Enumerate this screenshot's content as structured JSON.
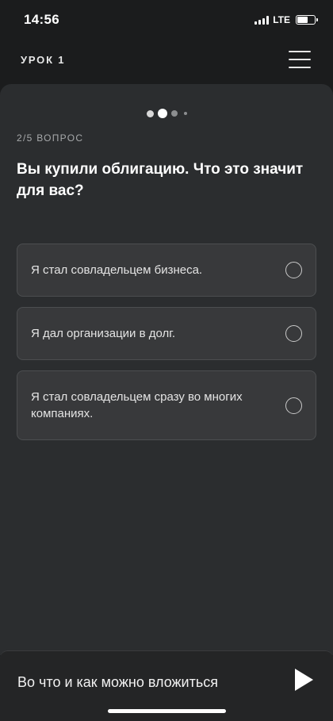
{
  "status_bar": {
    "time": "14:56",
    "network": "LTE",
    "battery_level": 0.6
  },
  "header": {
    "lesson_label": "УРОК 1",
    "menu_icon": "hamburger-menu-icon"
  },
  "progress": {
    "current": 2,
    "total": 4
  },
  "question": {
    "number_label": "2/5 ВОПРОС",
    "text": "Вы купили облигацию. Что это значит для вас?"
  },
  "answers": [
    {
      "label": "Я стал совладельцем бизнеса.",
      "selected": false
    },
    {
      "label": "Я дал организации в долг.",
      "selected": false
    },
    {
      "label": "Я стал совладельцем сразу во многих компаниях.",
      "selected": false
    }
  ],
  "footer": {
    "next_title": "Во что и как можно вложиться",
    "play_icon": "play-icon"
  },
  "colors": {
    "background": "#1b1c1d",
    "card": "#2b2d2f",
    "answer_bg": "#38393b",
    "text": "#ffffff"
  }
}
